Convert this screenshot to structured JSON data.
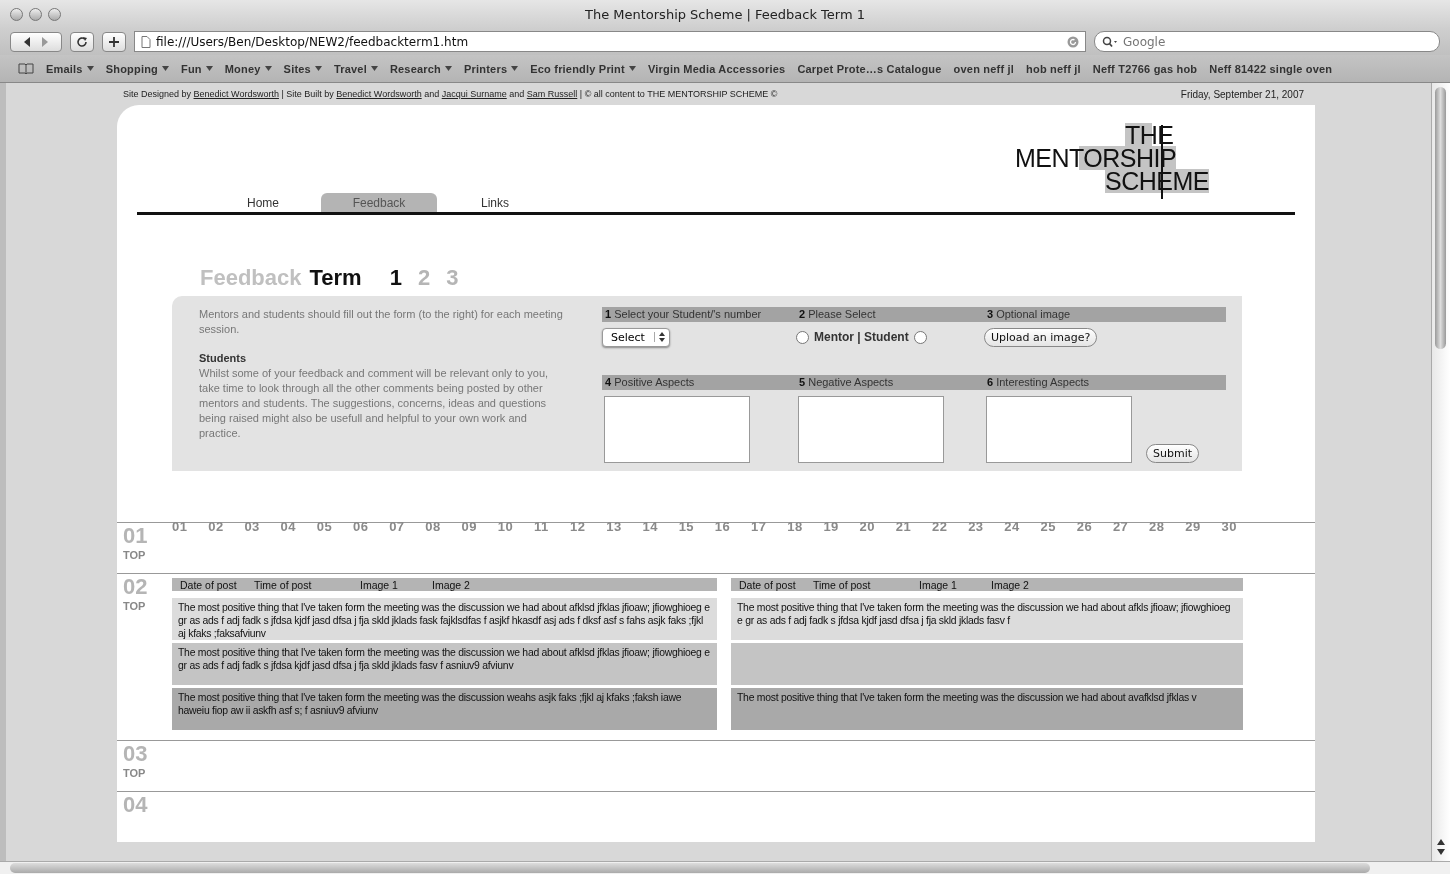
{
  "window": {
    "title": "The Mentorship Scheme | Feedback Term 1"
  },
  "toolbar": {
    "url": "file:///Users/Ben/Desktop/NEW2/feedbackterm1.htm",
    "search_placeholder": "Google"
  },
  "bookmarks": [
    {
      "label": "Emails",
      "menu": true
    },
    {
      "label": "Shopping",
      "menu": true
    },
    {
      "label": "Fun",
      "menu": true
    },
    {
      "label": "Money",
      "menu": true
    },
    {
      "label": "Sites",
      "menu": true
    },
    {
      "label": "Travel",
      "menu": true
    },
    {
      "label": "Research",
      "menu": true
    },
    {
      "label": "Printers",
      "menu": true
    },
    {
      "label": "Eco friendly Print",
      "menu": true
    },
    {
      "label": "Virgin Media Accessories",
      "menu": false
    },
    {
      "label": "Carpet Prote…s Catalogue",
      "menu": false
    },
    {
      "label": "oven neff jl",
      "menu": false
    },
    {
      "label": "hob neff jl",
      "menu": false
    },
    {
      "label": "Neff T2766 gas hob",
      "menu": false
    },
    {
      "label": "Neff 81422 single oven",
      "menu": false
    }
  ],
  "credits": [
    {
      "text": "Site Designed by ",
      "link": false
    },
    {
      "text": "Benedict Wordsworth",
      "link": true
    },
    {
      "text": " | Site Built by ",
      "link": false
    },
    {
      "text": "Benedict Wordsworth",
      "link": true
    },
    {
      "text": " and ",
      "link": false
    },
    {
      "text": "Jacqui Surname",
      "link": true
    },
    {
      "text": " and ",
      "link": false
    },
    {
      "text": "Sam Russell",
      "link": true
    },
    {
      "text": " | © all content to THE MENTORSHIP SCHEME ©",
      "link": false
    }
  ],
  "date": "Friday, September 21, 2007",
  "logo": [
    "THE",
    "MENTORSHIP",
    "SCHEME"
  ],
  "nav": [
    {
      "label": "Home",
      "selected": false
    },
    {
      "label": "Feedback",
      "selected": true
    },
    {
      "label": "Links",
      "selected": false
    }
  ],
  "heading": {
    "light": "Feedback",
    "bold": "Term",
    "terms": [
      {
        "label": "1",
        "selected": true
      },
      {
        "label": "2",
        "selected": false
      },
      {
        "label": "3",
        "selected": false
      }
    ]
  },
  "intro": {
    "text": "Mentors and students should fill out the form (to the right) for each meeting session.",
    "subheading": "Students",
    "body": "Whilst some of your feedback and comment will be relevant only to you, take time to look through all the other comments being posted by other mentors and students. The suggestions, concerns, ideas and questions being raised might also be usefull and helpful to your own work and practice."
  },
  "form_row_1": [
    {
      "number": "1",
      "label": "Select your Student/'s number",
      "kind": "select",
      "value": "Select"
    },
    {
      "number": "2",
      "label": "Please Select",
      "kind": "radio",
      "text": "Mentor | Student",
      "radios": [
        {
          "selected": false
        },
        {
          "selected": false
        }
      ]
    },
    {
      "number": "3",
      "label": "Optional image",
      "kind": "button",
      "value": "Upload an image?"
    }
  ],
  "form_row_2": [
    {
      "number": "4",
      "label": "Positive  Aspects"
    },
    {
      "number": "5",
      "label": "Negative Aspects"
    },
    {
      "number": "6",
      "label": "Interesting Aspects"
    }
  ],
  "submit": "Submit",
  "session_links": [
    "01",
    "02",
    "03",
    "04",
    "05",
    "06",
    "07",
    "08",
    "09",
    "10",
    "11",
    "12",
    "13",
    "14",
    "15",
    "16",
    "17",
    "18",
    "19",
    "20",
    "21",
    "22",
    "23",
    "24",
    "25",
    "26",
    "27",
    "28",
    "29",
    "30"
  ],
  "sessions": [
    {
      "number": "01",
      "top": "TOP"
    },
    {
      "number": "02",
      "top": "TOP",
      "columns": [
        {
          "headers": [
            "Date of post",
            "Time of post",
            "Image 1",
            "Image 2"
          ],
          "posts": [
            {
              "text": "The most positive thing that I've taken form the meeting was the discussion we had about afklsd jfklas jfioaw; jfiowghioeg e gr  as ads f adj fadk s jfdsa kjdf jasd dfsa j fja skld jklads fask fajklsdfas f asjkf hkasdf asj ads f dksf asf s fahs asjk faks ;fjkl aj kfaks ;faksafviunv",
              "color": "#dcdcdc"
            },
            {
              "text": "The most positive thing that I've taken form the meeting was the discussion we had about afklsd jfklas jfioaw; jfiowghioeg e gr  as ads f adj fadk s jfdsa kjdf jasd dfsa j fja skld jklads fasv f asniuv9 afviunv",
              "color": "#c4c4c4"
            },
            {
              "text": "The most positive thing that I've taken form the meeting was the discussion weahs asjk faks ;fjkl aj kfaks ;faksh iawe haweiu fiop aw ii askfh asf s; f asniuv9 afviunv",
              "color": "#a9a9a9"
            }
          ]
        },
        {
          "headers": [
            "Date of post",
            "Time of post",
            "Image 1",
            "Image 2"
          ],
          "posts": [
            {
              "text": "The most positive thing that I've taken form the meeting was the discussion we had about afkls jfioaw; jfiowghioeg e gr  as ads f adj fadk s jfdsa kjdf jasd dfsa j fja skld jklads fasv f",
              "color": "#dcdcdc"
            },
            {
              "color": "#c4c4c4"
            },
            {
              "text": "The most positive thing that I've taken form the meeting was the discussion we had about avafklsd jfklas v",
              "color": "#a9a9a9"
            }
          ]
        }
      ]
    },
    {
      "number": "03",
      "top": "TOP"
    },
    {
      "number": "04"
    }
  ]
}
